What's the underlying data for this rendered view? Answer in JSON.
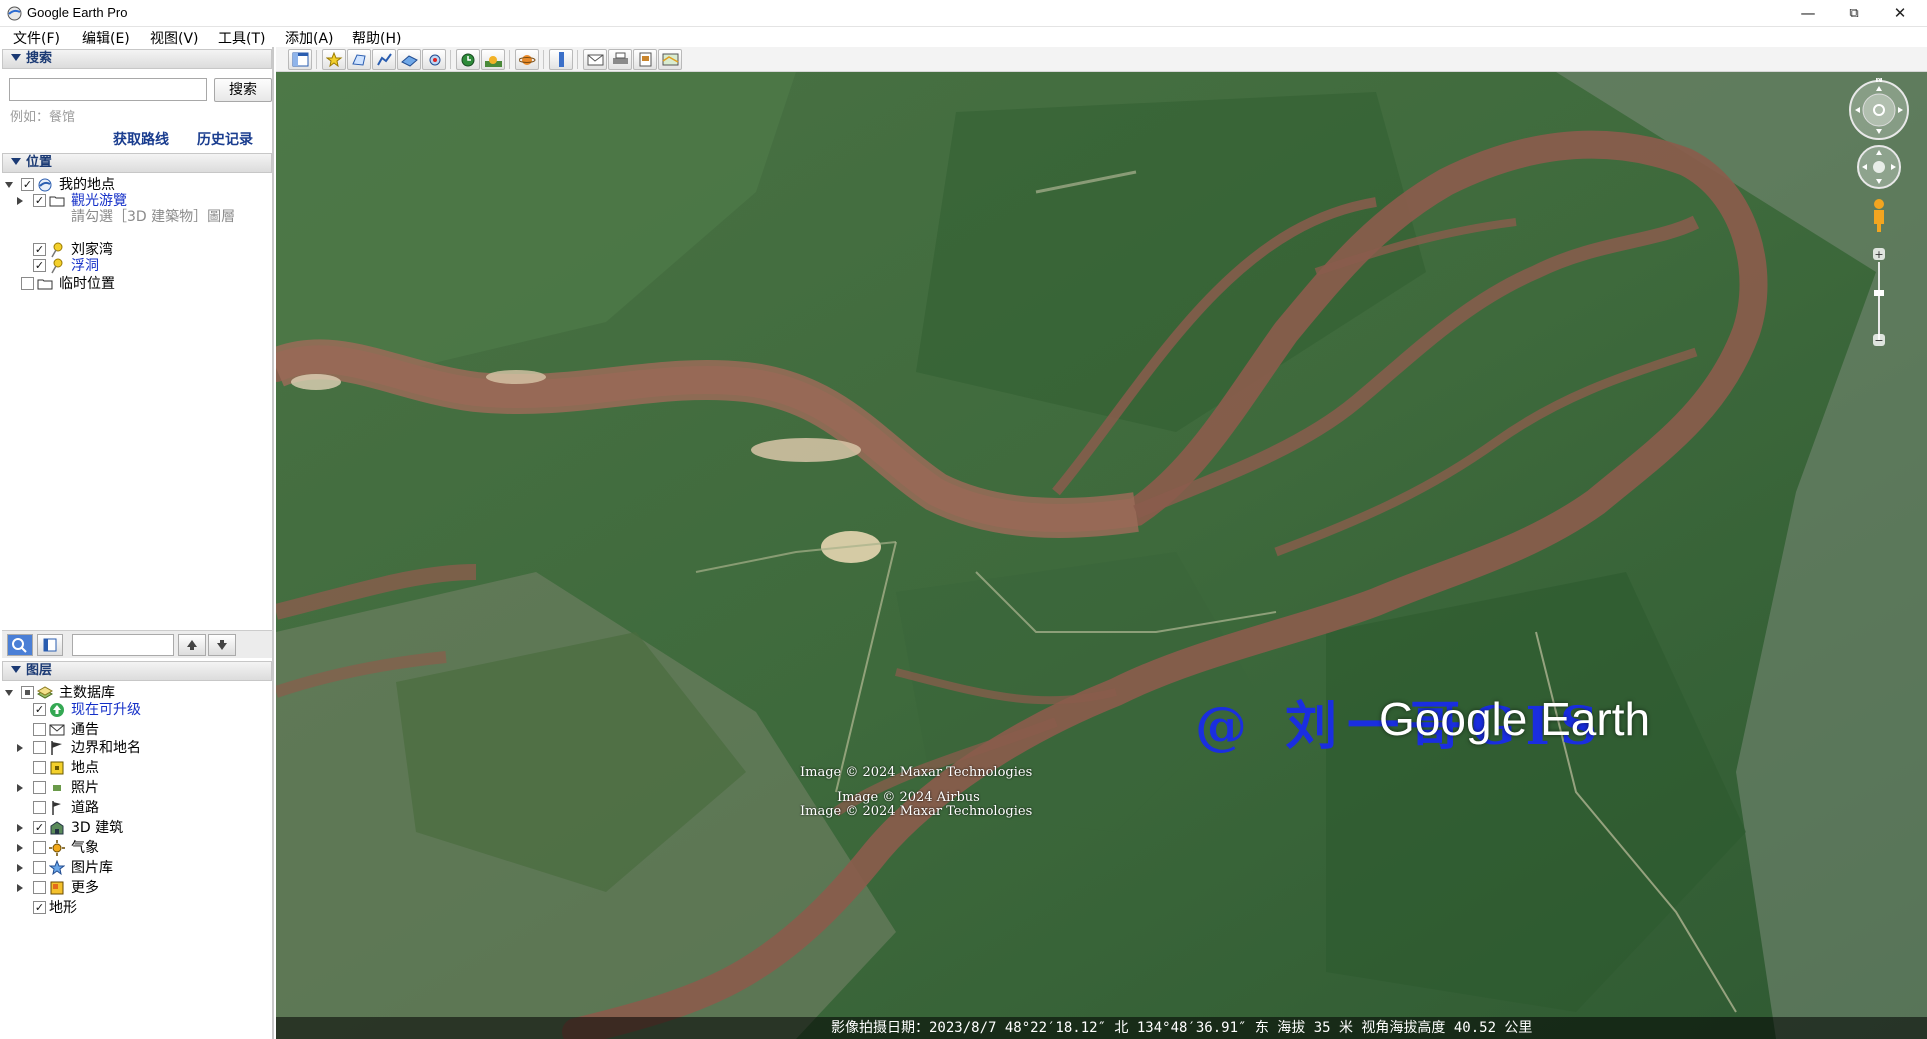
{
  "window": {
    "title": "Google Earth Pro",
    "minimize": "—",
    "maximize": "⧉",
    "close": "✕"
  },
  "menu": [
    {
      "label": "文件(F)"
    },
    {
      "label": "编辑(E)"
    },
    {
      "label": "视图(V)"
    },
    {
      "label": "工具(T)"
    },
    {
      "label": "添加(A)"
    },
    {
      "label": "帮助(H)"
    }
  ],
  "search": {
    "header": "搜索",
    "input_value": "",
    "button": "搜索",
    "hint": "例如：餐馆",
    "get_directions": "获取路线",
    "history": "历史记录"
  },
  "places": {
    "header": "位置",
    "items": [
      {
        "label": "我的地点"
      },
      {
        "label": "觀光游覽"
      },
      {
        "label": "請勾選［3D 建築物］圖層"
      },
      {
        "label": "刘家湾"
      },
      {
        "label": "浮洞"
      },
      {
        "label": "临时位置"
      }
    ]
  },
  "layers": {
    "header": "图层",
    "items": [
      {
        "label": "主数据库"
      },
      {
        "label": "现在可升级"
      },
      {
        "label": "通告"
      },
      {
        "label": "边界和地名"
      },
      {
        "label": "地点"
      },
      {
        "label": "照片"
      },
      {
        "label": "道路"
      },
      {
        "label": "3D 建筑"
      },
      {
        "label": "气象"
      },
      {
        "label": "图片库"
      },
      {
        "label": "更多"
      },
      {
        "label": "地形"
      }
    ]
  },
  "map": {
    "attribution_1": "Image © 2024 Maxar Technologies",
    "attribution_2": "Image © 2024 Airbus",
    "attribution_3": "Image © 2024 Maxar Technologies",
    "logo": "Google Earth",
    "watermark": "@ 刘一哥GIS",
    "north": "N",
    "status": "影像拍摄日期：2023/8/7   48°22′18.12″ 北 134°48′36.91″ 东 海拔    35 米    视角海拔高度   40.52 公里"
  },
  "colors": {
    "river": "#8a5a4a",
    "forest": "#3c6a3a",
    "title_blue": "#1b3a74",
    "link_blue": "#1530c8"
  }
}
